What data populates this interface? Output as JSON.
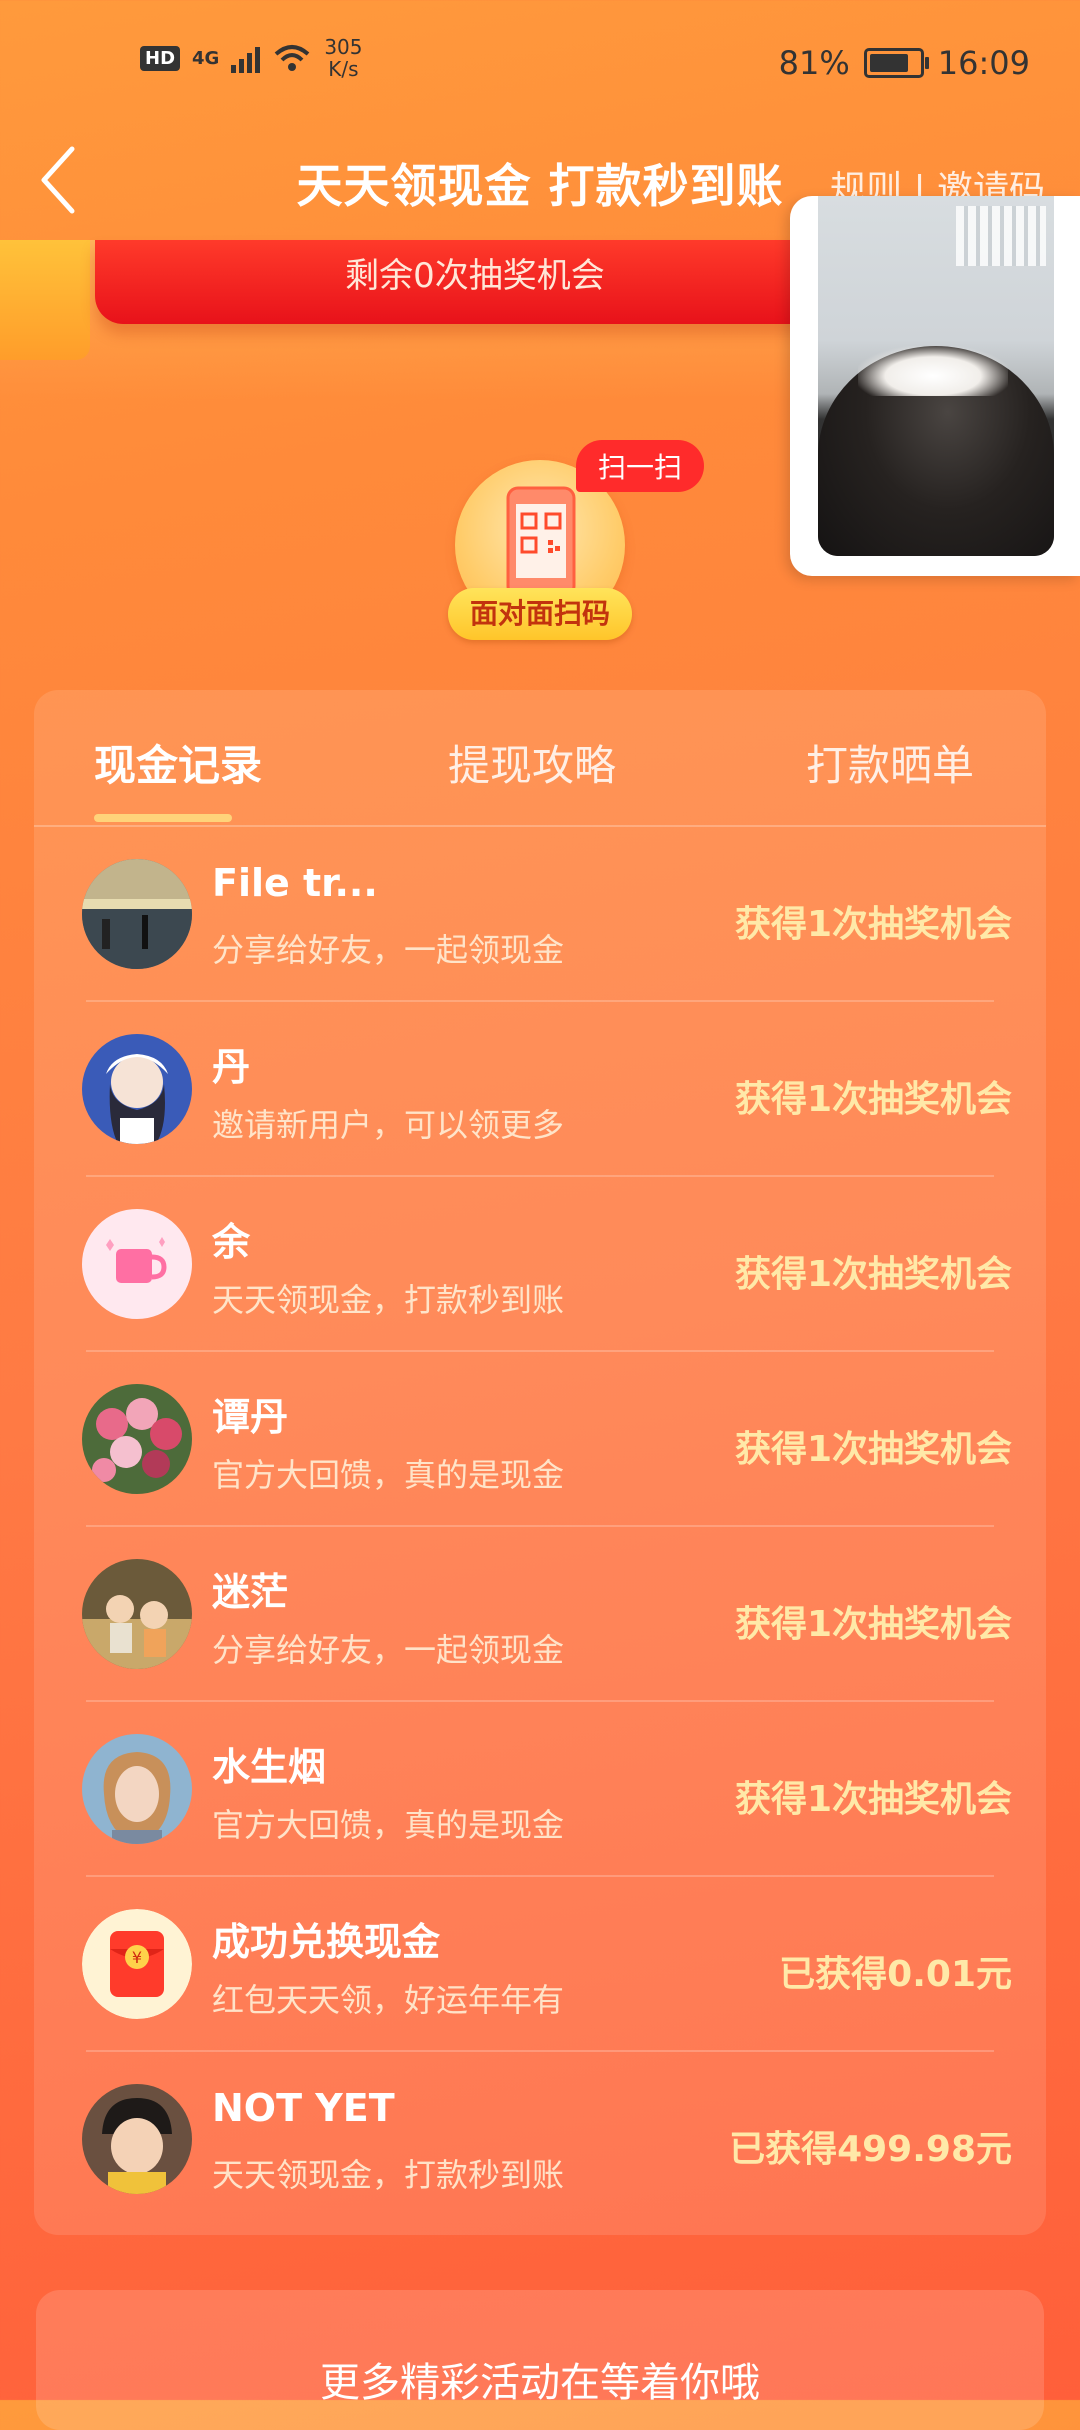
{
  "status_bar": {
    "hd": "HD",
    "network": "4G",
    "speed_value": "305",
    "speed_unit": "K/s",
    "battery": "81%",
    "battery_level": 0.81,
    "time": "16:09"
  },
  "header": {
    "title": "天天领现金 打款秒到账",
    "right_link": "规则 | 邀请码",
    "back_icon": "chevron-left-icon"
  },
  "chance_box": {
    "text": "剩余0次抽奖机会"
  },
  "scan": {
    "badge": "扫一扫",
    "label": "面对面扫码",
    "icon": "qr-phone-icon"
  },
  "tabs": [
    {
      "label": "现金记录",
      "active": true
    },
    {
      "label": "提现攻略",
      "active": false
    },
    {
      "label": "打款晒单",
      "active": false
    }
  ],
  "records": [
    {
      "name": "File tr...",
      "desc": "分享给好友，一起领现金",
      "reward": "获得1次抽奖机会",
      "avatar": "photo-station"
    },
    {
      "name": "丹",
      "desc": "邀请新用户，可以领更多",
      "reward": "获得1次抽奖机会",
      "avatar": "photo-girl-illustration"
    },
    {
      "name": "余",
      "desc": "天天领现金，打款秒到账",
      "reward": "获得1次抽奖机会",
      "avatar": "cup-icon"
    },
    {
      "name": "谭丹",
      "desc": "官方大回馈，真的是现金",
      "reward": "获得1次抽奖机会",
      "avatar": "photo-flowers"
    },
    {
      "name": "迷茫",
      "desc": "分享给好友，一起领现金",
      "reward": "获得1次抽奖机会",
      "avatar": "photo-cartoon"
    },
    {
      "name": "水生烟",
      "desc": "官方大回馈，真的是现金",
      "reward": "获得1次抽奖机会",
      "avatar": "photo-girl"
    },
    {
      "name": "成功兑换现金",
      "desc": "红包天天领，好运年年有",
      "reward": "已获得0.01元",
      "avatar": "red-envelope-icon"
    },
    {
      "name": "NOT YET",
      "desc": "天天领现金，打款秒到账",
      "reward": "已获得499.98元",
      "avatar": "photo-child"
    }
  ],
  "bottom": {
    "text": "更多精彩活动在等着你哦"
  },
  "colors": {
    "bg_top": "#ff9a3c",
    "bg_bottom": "#ff5f3a",
    "reward": "#ffe9a8",
    "badge_red": "#ff2b2b"
  }
}
